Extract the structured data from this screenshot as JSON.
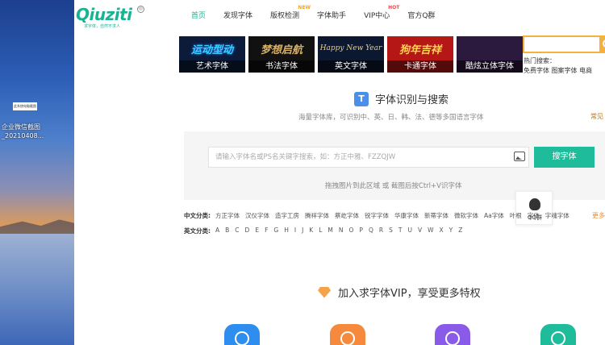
{
  "desktop": {
    "icon_text": "此系统电脑截图",
    "file_label": "企业微信截图_20210408..."
  },
  "logo": {
    "text": "Qiuziti",
    "slogan": "求字体，自然不求人",
    "registered": "®"
  },
  "nav": {
    "items": [
      {
        "label": "首页",
        "badge": ""
      },
      {
        "label": "发现字体",
        "badge": ""
      },
      {
        "label": "版权检测",
        "badge": "NEW"
      },
      {
        "label": "字体助手",
        "badge": ""
      },
      {
        "label": "VIP中心",
        "badge": "HOT"
      },
      {
        "label": "官方Q群",
        "badge": ""
      }
    ],
    "active_index": 0
  },
  "banners": [
    {
      "art": "运动型动",
      "label": "艺术字体"
    },
    {
      "art": "梦想启航",
      "label": "书法字体"
    },
    {
      "art": "Happy New Year",
      "label": "英文字体"
    },
    {
      "art": "狗年吉祥",
      "label": "卡通字体"
    },
    {
      "art": "",
      "label": "酷炫立体字体"
    }
  ],
  "top_search": {
    "placeholder": "",
    "hot_label": "热门搜索：",
    "hot_items": "免费字体  图案字体  电商"
  },
  "section": {
    "icon": "T",
    "title": "字体识别与搜索",
    "desc": "海量字体库，可识别中、英、日、韩、法、德等多国语言字体",
    "more": "常见"
  },
  "search": {
    "placeholder": "请输入字体名或PS名关键字搜索，如：方正中雅、FZZQJW",
    "button": "搜字体",
    "drag_hint": "拖拽图片到此区域 或 截图后按Ctrl+V识字体"
  },
  "qq_float": {
    "label": "QQ群"
  },
  "categories": {
    "cn_label": "中文分类:",
    "cn_items": [
      "方正字体",
      "汉仪字体",
      "造字工房",
      "腾祥字体",
      "蔡屹字体",
      "锐字字体",
      "华康字体",
      "新蒂字体",
      "微软字体",
      "Aa字体",
      "叶根",
      "字体",
      "字魂字体"
    ],
    "more": "更多",
    "en_label": "英文分类:",
    "en_items": [
      "A",
      "B",
      "C",
      "D",
      "E",
      "F",
      "G",
      "H",
      "I",
      "J",
      "K",
      "L",
      "M",
      "N",
      "O",
      "P",
      "Q",
      "R",
      "S",
      "T",
      "U",
      "V",
      "W",
      "X",
      "Y",
      "Z"
    ]
  },
  "vip": {
    "title": "加入求字体VIP，享受更多特权"
  },
  "colors": {
    "accent": "#1fbc9c",
    "orange": "#f4b13f"
  }
}
